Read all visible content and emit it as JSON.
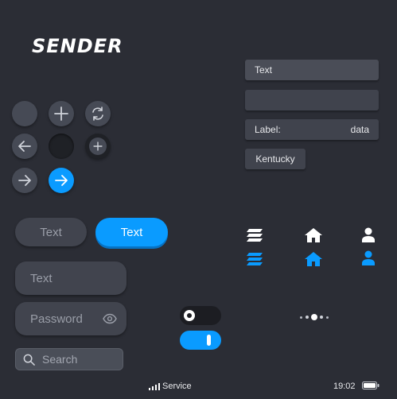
{
  "logo": {
    "text": "SENDER"
  },
  "icons": {
    "plus": "plus-icon",
    "refresh": "refresh-icon",
    "arrow_left": "arrow-left-icon",
    "arrow_right": "arrow-right-icon",
    "layers": "layers-icon",
    "home": "home-icon",
    "user": "user-icon",
    "eye": "eye-icon",
    "search": "search-icon"
  },
  "buttons": {
    "gray_label": "Text",
    "blue_label": "Text"
  },
  "inputs": {
    "text_placeholder": "Text",
    "password_placeholder": "Password",
    "search_placeholder": "Search"
  },
  "fields": {
    "field1": "Text",
    "field2": "",
    "label": "Label:",
    "value": "data",
    "chip": "Kentucky"
  },
  "status_bar": {
    "carrier": "Service",
    "time": "19:02"
  },
  "colors": {
    "accent": "#0a9bff",
    "background": "#2b2d35",
    "surface": "#41444e"
  }
}
